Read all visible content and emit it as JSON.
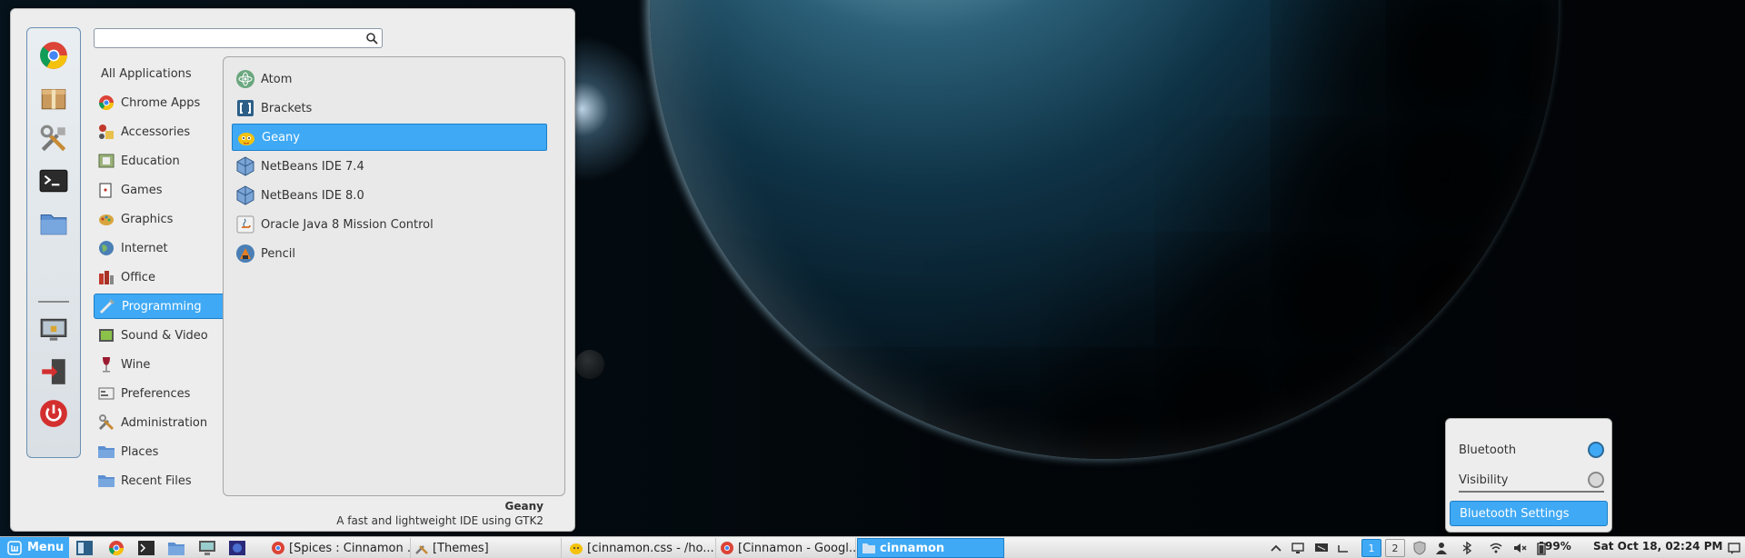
{
  "search": {
    "value": "",
    "placeholder": ""
  },
  "favorites": [
    {
      "name": "Google Chrome",
      "icon": "chrome-icon"
    },
    {
      "name": "Package Manager",
      "icon": "package-icon"
    },
    {
      "name": "Settings",
      "icon": "settings-tools-icon"
    },
    {
      "name": "Terminal",
      "icon": "terminal-icon"
    },
    {
      "name": "Files",
      "icon": "folder-icon"
    },
    {
      "name": "Lock Screen",
      "icon": "lock-screen-icon"
    },
    {
      "name": "Logout",
      "icon": "logout-icon"
    },
    {
      "name": "Quit",
      "icon": "power-icon"
    }
  ],
  "categories": [
    {
      "label": "All Applications",
      "icon": ""
    },
    {
      "label": "Chrome Apps",
      "icon": "chrome-icon"
    },
    {
      "label": "Accessories",
      "icon": "accessories-icon"
    },
    {
      "label": "Education",
      "icon": "education-icon"
    },
    {
      "label": "Games",
      "icon": "games-icon"
    },
    {
      "label": "Graphics",
      "icon": "graphics-icon"
    },
    {
      "label": "Internet",
      "icon": "globe-icon"
    },
    {
      "label": "Office",
      "icon": "office-icon"
    },
    {
      "label": "Programming",
      "icon": "programming-icon",
      "selected": true
    },
    {
      "label": "Sound & Video",
      "icon": "sound-video-icon"
    },
    {
      "label": "Wine",
      "icon": "wine-icon"
    },
    {
      "label": "Preferences",
      "icon": "preferences-icon"
    },
    {
      "label": "Administration",
      "icon": "administration-icon"
    },
    {
      "label": "Places",
      "icon": "folder-icon"
    },
    {
      "label": "Recent Files",
      "icon": "folder-icon"
    }
  ],
  "apps": [
    {
      "label": "Atom",
      "icon": "atom-icon"
    },
    {
      "label": "Brackets",
      "icon": "brackets-icon"
    },
    {
      "label": "Geany",
      "icon": "geany-icon",
      "selected": true
    },
    {
      "label": "NetBeans IDE 7.4",
      "icon": "netbeans-icon"
    },
    {
      "label": "NetBeans IDE 8.0",
      "icon": "netbeans-icon"
    },
    {
      "label": "Oracle Java 8 Mission Control",
      "icon": "java-icon"
    },
    {
      "label": "Pencil",
      "icon": "pencil-icon"
    }
  ],
  "description": {
    "title": "Geany",
    "text": "A fast and lightweight IDE using GTK2"
  },
  "bluetooth": {
    "bluetooth_label": "Bluetooth",
    "bluetooth_on": true,
    "visibility_label": "Visibility",
    "visibility_on": false,
    "settings_label": "Bluetooth Settings"
  },
  "panel": {
    "menu_label": "Menu",
    "tasks": [
      {
        "label": "[Spices : Cinnamon ...",
        "icon": "chrome-icon"
      },
      {
        "label": "[Themes]",
        "icon": "settings-tools-icon"
      },
      {
        "label": "[cinnamon.css - /ho...",
        "icon": "geany-icon"
      },
      {
        "label": "[Cinnamon - Googl...",
        "icon": "chrome-icon"
      },
      {
        "label": "cinnamon",
        "icon": "folder-icon",
        "active": true
      }
    ],
    "workspaces": [
      "1",
      "2"
    ],
    "battery": "99%",
    "clock": "Sat Oct 18, 02:24 PM"
  },
  "colors": {
    "accent": "#3fa9f5",
    "accent_border": "#1b7fc8",
    "menu_bg": "#ededed"
  }
}
